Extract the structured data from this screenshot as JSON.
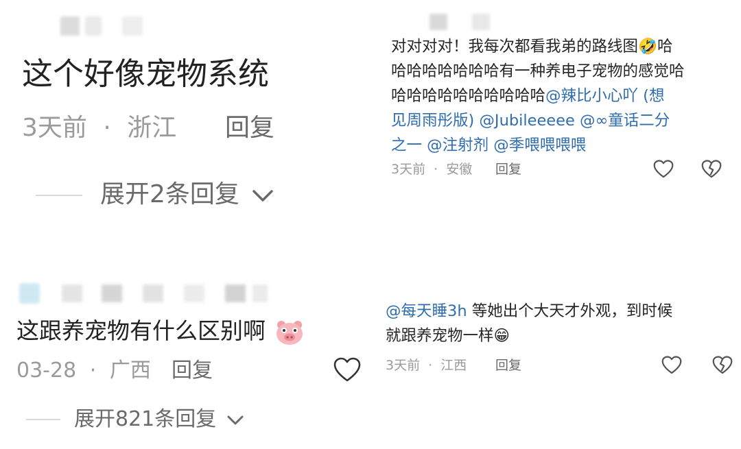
{
  "panel_top_left": {
    "comment": "这个好像宠物系统",
    "time": "3天前",
    "separator": "·",
    "location": "浙江",
    "reply_label": "回复",
    "expand_label": "展开2条回复"
  },
  "panel_bottom_left": {
    "comment": "这跟养宠物有什么区别啊",
    "time": "03-28",
    "separator": "·",
    "location": "广西",
    "reply_label": "回复",
    "expand_label": "展开821条回复"
  },
  "panel_top_right": {
    "lines": [
      [
        {
          "t": "对对对对！我每次都看我弟的路线图",
          "m": false
        },
        {
          "t": "🤣",
          "m": false,
          "e": true
        },
        {
          "t": "哈",
          "m": false
        }
      ],
      [
        {
          "t": "哈哈哈哈哈哈哈有一种养电子宠物的感觉哈",
          "m": false
        }
      ],
      [
        {
          "t": "哈哈哈哈哈哈哈哈哈哈",
          "m": false
        },
        {
          "t": "@辣比小心吖 (想",
          "m": true
        }
      ],
      [
        {
          "t": "见周雨彤版) @Jubileeeee @∞童话二分",
          "m": true
        }
      ],
      [
        {
          "t": "之一 @注射剂 @季喂喂喂喂",
          "m": true
        }
      ]
    ],
    "time": "3天前",
    "separator": "·",
    "location": "安徽",
    "reply_label": "回复"
  },
  "panel_bottom_right": {
    "lines": [
      [
        {
          "t": "@每天睡3h",
          "m": true
        },
        {
          "t": " 等她出个大天才外观，到时候",
          "m": false
        }
      ],
      [
        {
          "t": "就跟养宠物一样",
          "m": false
        },
        {
          "t": "😁",
          "m": false,
          "e": true
        }
      ]
    ],
    "time": "3天前",
    "separator": "·",
    "location": "江西",
    "reply_label": "回复"
  },
  "icons": {
    "like": "heart-outline-icon",
    "dislike": "broken-heart-icon",
    "chevron": "chevron-down-icon",
    "pig": "pig-face-emoji"
  },
  "colors": {
    "mention": "#2f6dae",
    "meta": "#9a9a9a",
    "text": "#262626"
  }
}
